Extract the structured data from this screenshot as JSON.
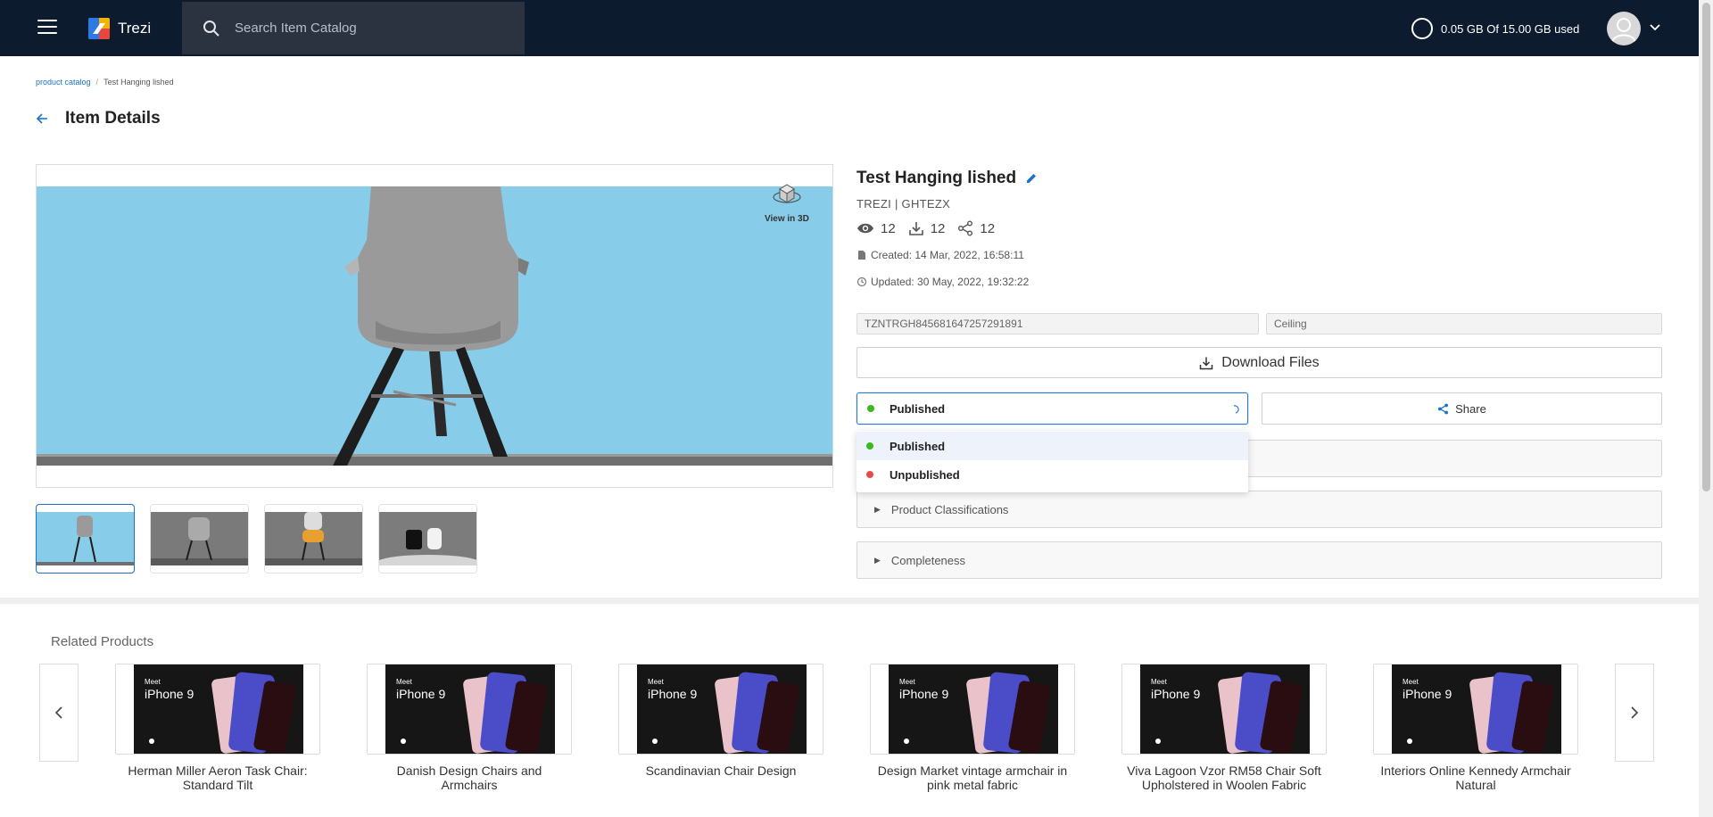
{
  "app": {
    "name": "Trezi"
  },
  "search": {
    "placeholder": "Search Item Catalog"
  },
  "storage": {
    "text": "0.05 GB Of 15.00 GB used"
  },
  "breadcrumb": {
    "root": "product catalog",
    "current": "Test Hanging lished"
  },
  "page": {
    "title": "Item Details"
  },
  "viewer": {
    "view3d_label": "View in 3D"
  },
  "item": {
    "title": "Test Hanging lished",
    "brand_line": "TREZI | GHTEZX",
    "views": "12",
    "downloads": "12",
    "shares": "12",
    "created": "Created: 14 Mar, 2022, 16:58:11",
    "updated": "Updated: 30 May, 2022, 19:32:22",
    "sku": "TZNTRGH845681647257291891",
    "category": "Ceiling"
  },
  "actions": {
    "download_label": "Download Files",
    "share_label": "Share"
  },
  "status": {
    "selected": "Published",
    "options": [
      {
        "label": "Published",
        "color": "#3cb81c"
      },
      {
        "label": "Unpublished",
        "color": "#e84a4a"
      }
    ]
  },
  "accordions": {
    "classifications": "Product Classifications",
    "completeness": "Completeness"
  },
  "related": {
    "title": "Related Products",
    "image_text_meet": "Meet",
    "image_text_model": "iPhone 9",
    "products": [
      {
        "name": "Herman Miller Aeron Task Chair: Standard Tilt"
      },
      {
        "name": "Danish Design Chairs and Armchairs"
      },
      {
        "name": "Scandinavian Chair Design"
      },
      {
        "name": "Design Market vintage armchair in pink metal fabric"
      },
      {
        "name": "Viva Lagoon Vzor RM58 Chair Soft Upholstered in Woolen Fabric"
      },
      {
        "name": "Interiors Online Kennedy Armchair Natural"
      }
    ]
  },
  "colors": {
    "topbar": "#0c1b2e",
    "accent": "#1a73c9",
    "viewer_sky": "#87cce8"
  }
}
